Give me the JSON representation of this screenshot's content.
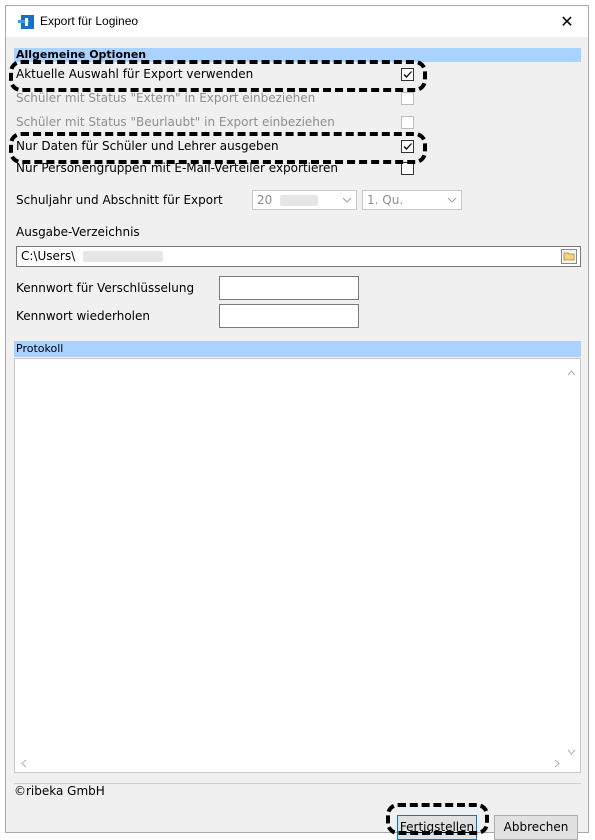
{
  "window": {
    "title": "Export für Logineo",
    "close_glyph": "✕",
    "app_icon": "logineo-app-icon"
  },
  "options": {
    "header": "Allgemeine Optionen",
    "items": [
      {
        "label": "Aktuelle Auswahl für Export verwenden",
        "checked": true,
        "enabled": true
      },
      {
        "label": "Schüler mit Status \"Extern\" in Export einbeziehen",
        "checked": false,
        "enabled": false
      },
      {
        "label": "Schüler mit Status \"Beurlaubt\" in Export einbeziehen",
        "checked": false,
        "enabled": false
      },
      {
        "label": "Nur Daten für Schüler und Lehrer ausgeben",
        "checked": true,
        "enabled": true
      },
      {
        "label": "Nur Personengruppen mit E-Mail-Verteiler exportieren",
        "checked": false,
        "enabled": true
      }
    ],
    "schuljahr_label": "Schuljahr und Abschnitt für Export",
    "schuljahr_value": "20",
    "abschnitt_value": "1. Qu.",
    "ausgabe_label": "Ausgabe-Verzeichnis",
    "ausgabe_value": "C:\\Users\\",
    "kennwort_label": "Kennwort für Verschlüsselung",
    "kennwort_value": "",
    "kennwort_wdh_label": "Kennwort wiederholen",
    "kennwort_wdh_value": ""
  },
  "protokoll": {
    "header": "Protokoll"
  },
  "status": {
    "copyright": "©ribeka GmbH"
  },
  "buttons": {
    "finish": "Fertigstellen",
    "cancel": "Abbrechen"
  },
  "colors": {
    "section_header": "#a9d2ff",
    "annotation": "#000000",
    "focus_border": "#0078d7"
  }
}
